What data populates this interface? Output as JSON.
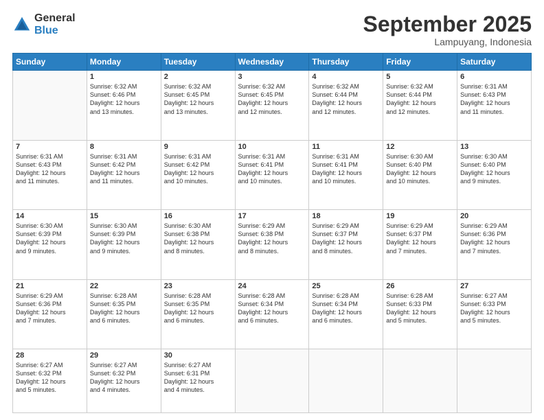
{
  "logo": {
    "general": "General",
    "blue": "Blue"
  },
  "header": {
    "month": "September 2025",
    "location": "Lampuyang, Indonesia"
  },
  "weekdays": [
    "Sunday",
    "Monday",
    "Tuesday",
    "Wednesday",
    "Thursday",
    "Friday",
    "Saturday"
  ],
  "weeks": [
    [
      {
        "day": "",
        "info": ""
      },
      {
        "day": "1",
        "info": "Sunrise: 6:32 AM\nSunset: 6:46 PM\nDaylight: 12 hours\nand 13 minutes."
      },
      {
        "day": "2",
        "info": "Sunrise: 6:32 AM\nSunset: 6:45 PM\nDaylight: 12 hours\nand 13 minutes."
      },
      {
        "day": "3",
        "info": "Sunrise: 6:32 AM\nSunset: 6:45 PM\nDaylight: 12 hours\nand 12 minutes."
      },
      {
        "day": "4",
        "info": "Sunrise: 6:32 AM\nSunset: 6:44 PM\nDaylight: 12 hours\nand 12 minutes."
      },
      {
        "day": "5",
        "info": "Sunrise: 6:32 AM\nSunset: 6:44 PM\nDaylight: 12 hours\nand 12 minutes."
      },
      {
        "day": "6",
        "info": "Sunrise: 6:31 AM\nSunset: 6:43 PM\nDaylight: 12 hours\nand 11 minutes."
      }
    ],
    [
      {
        "day": "7",
        "info": "Sunrise: 6:31 AM\nSunset: 6:43 PM\nDaylight: 12 hours\nand 11 minutes."
      },
      {
        "day": "8",
        "info": "Sunrise: 6:31 AM\nSunset: 6:42 PM\nDaylight: 12 hours\nand 11 minutes."
      },
      {
        "day": "9",
        "info": "Sunrise: 6:31 AM\nSunset: 6:42 PM\nDaylight: 12 hours\nand 10 minutes."
      },
      {
        "day": "10",
        "info": "Sunrise: 6:31 AM\nSunset: 6:41 PM\nDaylight: 12 hours\nand 10 minutes."
      },
      {
        "day": "11",
        "info": "Sunrise: 6:31 AM\nSunset: 6:41 PM\nDaylight: 12 hours\nand 10 minutes."
      },
      {
        "day": "12",
        "info": "Sunrise: 6:30 AM\nSunset: 6:40 PM\nDaylight: 12 hours\nand 10 minutes."
      },
      {
        "day": "13",
        "info": "Sunrise: 6:30 AM\nSunset: 6:40 PM\nDaylight: 12 hours\nand 9 minutes."
      }
    ],
    [
      {
        "day": "14",
        "info": "Sunrise: 6:30 AM\nSunset: 6:39 PM\nDaylight: 12 hours\nand 9 minutes."
      },
      {
        "day": "15",
        "info": "Sunrise: 6:30 AM\nSunset: 6:39 PM\nDaylight: 12 hours\nand 9 minutes."
      },
      {
        "day": "16",
        "info": "Sunrise: 6:30 AM\nSunset: 6:38 PM\nDaylight: 12 hours\nand 8 minutes."
      },
      {
        "day": "17",
        "info": "Sunrise: 6:29 AM\nSunset: 6:38 PM\nDaylight: 12 hours\nand 8 minutes."
      },
      {
        "day": "18",
        "info": "Sunrise: 6:29 AM\nSunset: 6:37 PM\nDaylight: 12 hours\nand 8 minutes."
      },
      {
        "day": "19",
        "info": "Sunrise: 6:29 AM\nSunset: 6:37 PM\nDaylight: 12 hours\nand 7 minutes."
      },
      {
        "day": "20",
        "info": "Sunrise: 6:29 AM\nSunset: 6:36 PM\nDaylight: 12 hours\nand 7 minutes."
      }
    ],
    [
      {
        "day": "21",
        "info": "Sunrise: 6:29 AM\nSunset: 6:36 PM\nDaylight: 12 hours\nand 7 minutes."
      },
      {
        "day": "22",
        "info": "Sunrise: 6:28 AM\nSunset: 6:35 PM\nDaylight: 12 hours\nand 6 minutes."
      },
      {
        "day": "23",
        "info": "Sunrise: 6:28 AM\nSunset: 6:35 PM\nDaylight: 12 hours\nand 6 minutes."
      },
      {
        "day": "24",
        "info": "Sunrise: 6:28 AM\nSunset: 6:34 PM\nDaylight: 12 hours\nand 6 minutes."
      },
      {
        "day": "25",
        "info": "Sunrise: 6:28 AM\nSunset: 6:34 PM\nDaylight: 12 hours\nand 6 minutes."
      },
      {
        "day": "26",
        "info": "Sunrise: 6:28 AM\nSunset: 6:33 PM\nDaylight: 12 hours\nand 5 minutes."
      },
      {
        "day": "27",
        "info": "Sunrise: 6:27 AM\nSunset: 6:33 PM\nDaylight: 12 hours\nand 5 minutes."
      }
    ],
    [
      {
        "day": "28",
        "info": "Sunrise: 6:27 AM\nSunset: 6:32 PM\nDaylight: 12 hours\nand 5 minutes."
      },
      {
        "day": "29",
        "info": "Sunrise: 6:27 AM\nSunset: 6:32 PM\nDaylight: 12 hours\nand 4 minutes."
      },
      {
        "day": "30",
        "info": "Sunrise: 6:27 AM\nSunset: 6:31 PM\nDaylight: 12 hours\nand 4 minutes."
      },
      {
        "day": "",
        "info": ""
      },
      {
        "day": "",
        "info": ""
      },
      {
        "day": "",
        "info": ""
      },
      {
        "day": "",
        "info": ""
      }
    ]
  ]
}
